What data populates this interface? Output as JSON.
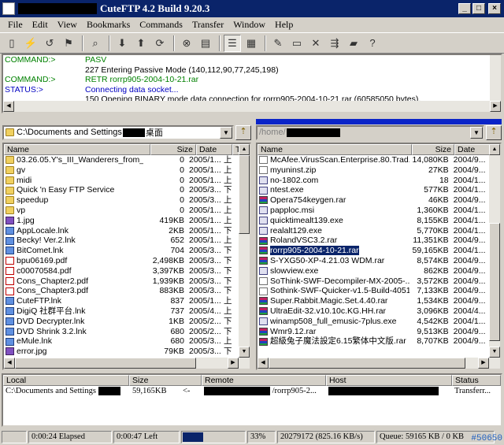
{
  "window": {
    "title": "CuteFTP 4.2 Build 9.20.3",
    "buttons": [
      "_",
      "□",
      "×"
    ]
  },
  "menu": [
    "File",
    "Edit",
    "View",
    "Bookmarks",
    "Commands",
    "Transfer",
    "Window",
    "Help"
  ],
  "toolbar_icons": [
    "connect-icon",
    "disconnect-icon",
    "reconnect-icon",
    "quick-connect-icon",
    "find-icon",
    "download-icon",
    "upload-icon",
    "refresh-icon",
    "stop-icon",
    "copy-icon",
    "list-view-icon",
    "details-view-icon",
    "edit-icon",
    "rename-icon",
    "delete-icon",
    "queue-icon",
    "new-folder-icon",
    "help-icon"
  ],
  "log": [
    {
      "label": "COMMAND:>",
      "msg": "PASV",
      "label_color": "green",
      "msg_color": "green"
    },
    {
      "label": "",
      "msg": "227 Entering Passive Mode (140,112,90,77,245,198)",
      "label_color": "black",
      "msg_color": "black"
    },
    {
      "label": "COMMAND:>",
      "msg": "RETR rorrp905-2004-10-21.rar",
      "label_color": "green",
      "msg_color": "green"
    },
    {
      "label": "STATUS:>",
      "msg": "Connecting data socket...",
      "label_color": "blue",
      "msg_color": "blue"
    },
    {
      "label": "",
      "msg": "150 Opening BINARY mode data connection for rorrp905-2004-10-21.rar (60585050 bytes).",
      "label_color": "black",
      "msg_color": "black"
    }
  ],
  "local": {
    "path_prefix": "C:\\Documents and Settings",
    "path_suffix": "桌面",
    "headers": {
      "name": "Name",
      "size": "Size",
      "date": "Date",
      "time": "T"
    },
    "files": [
      {
        "name": "03.26.05.Y's_III_Wanderers_from_Y...",
        "size": "0",
        "date": "2005/1...",
        "t": "上",
        "icon": "folder"
      },
      {
        "name": "gv",
        "size": "0",
        "date": "2005/1...",
        "t": "上",
        "icon": "folder"
      },
      {
        "name": "midi",
        "size": "0",
        "date": "2005/1...",
        "t": "上",
        "icon": "folder"
      },
      {
        "name": "Quick 'n Easy FTP Service",
        "size": "0",
        "date": "2005/3...",
        "t": "下",
        "icon": "folder"
      },
      {
        "name": "speedup",
        "size": "0",
        "date": "2005/3...",
        "t": "上",
        "icon": "folder"
      },
      {
        "name": "vp",
        "size": "0",
        "date": "2005/1...",
        "t": "上",
        "icon": "folder"
      },
      {
        "name": "1.jpg",
        "size": "419KB",
        "date": "2005/1...",
        "t": "上",
        "icon": "img"
      },
      {
        "name": "AppLocale.lnk",
        "size": "2KB",
        "date": "2005/1...",
        "t": "下",
        "icon": "lnk"
      },
      {
        "name": "Becky! Ver.2.lnk",
        "size": "652",
        "date": "2005/1...",
        "t": "上",
        "icon": "lnk"
      },
      {
        "name": "BitComet.lnk",
        "size": "704",
        "date": "2005/3...",
        "t": "下",
        "icon": "lnk"
      },
      {
        "name": "bpu06169.pdf",
        "size": "2,498KB",
        "date": "2005/3...",
        "t": "下",
        "icon": "pdf"
      },
      {
        "name": "c00070584.pdf",
        "size": "3,397KB",
        "date": "2005/3...",
        "t": "下",
        "icon": "pdf"
      },
      {
        "name": "Cons_Chapter2.pdf",
        "size": "1,939KB",
        "date": "2005/3...",
        "t": "下",
        "icon": "pdf"
      },
      {
        "name": "Cons_Chapter3.pdf",
        "size": "883KB",
        "date": "2005/3...",
        "t": "下",
        "icon": "pdf"
      },
      {
        "name": "CuteFTP.lnk",
        "size": "837",
        "date": "2005/1...",
        "t": "上",
        "icon": "lnk"
      },
      {
        "name": "DigiQ 社群平台.lnk",
        "size": "737",
        "date": "2005/4...",
        "t": "上",
        "icon": "lnk"
      },
      {
        "name": "DVD Decrypter.lnk",
        "size": "1KB",
        "date": "2005/2...",
        "t": "下",
        "icon": "lnk"
      },
      {
        "name": "DVD Shrink 3.2.lnk",
        "size": "680",
        "date": "2005/2...",
        "t": "下",
        "icon": "lnk"
      },
      {
        "name": "eMule.lnk",
        "size": "680",
        "date": "2005/3...",
        "t": "上",
        "icon": "lnk"
      },
      {
        "name": "error.jpg",
        "size": "79KB",
        "date": "2005/3...",
        "t": "下",
        "icon": "img"
      }
    ]
  },
  "remote": {
    "path_prefix": "/home/",
    "headers": {
      "name": "Name",
      "size": "Size",
      "date": "Date"
    },
    "selected": "rorrp905-2004-10-21.rar",
    "files": [
      {
        "name": "McAfee.VirusScan.Enterprise.80.Trad...",
        "size": "14,080KB",
        "date": "2004/9..."
      },
      {
        "name": "myuninst.zip",
        "size": "27KB",
        "date": "2004/9..."
      },
      {
        "name": "no-1802.com",
        "size": "18",
        "date": "2004/1..."
      },
      {
        "name": "ntest.exe",
        "size": "577KB",
        "date": "2004/1..."
      },
      {
        "name": "Opera754keygen.rar",
        "size": "46KB",
        "date": "2004/9..."
      },
      {
        "name": "papploc.msi",
        "size": "1,360KB",
        "date": "2004/1..."
      },
      {
        "name": "quicktimealt139.exe",
        "size": "8,155KB",
        "date": "2004/1..."
      },
      {
        "name": "realalt129.exe",
        "size": "5,770KB",
        "date": "2004/1..."
      },
      {
        "name": "RolandVSC3.2.rar",
        "size": "11,351KB",
        "date": "2004/9..."
      },
      {
        "name": "rorrp905-2004-10-21.rar",
        "size": "59,165KB",
        "date": "2004/1..."
      },
      {
        "name": "S-YXG50-XP-4.21.03 WDM.rar",
        "size": "8,574KB",
        "date": "2004/9..."
      },
      {
        "name": "slowview.exe",
        "size": "862KB",
        "date": "2004/9..."
      },
      {
        "name": "SoThink-SWF-Decompiler-MX-2005-...",
        "size": "3,572KB",
        "date": "2004/9..."
      },
      {
        "name": "Sothink-SWF-Quicker-v1.5-Build-4051...",
        "size": "7,133KB",
        "date": "2004/9..."
      },
      {
        "name": "Super.Rabbit.Magic.Set.4.40.rar",
        "size": "1,534KB",
        "date": "2004/9..."
      },
      {
        "name": "UltraEdit-32.v10.10c.KG.HH.rar",
        "size": "3,096KB",
        "date": "2004/4..."
      },
      {
        "name": "winamp508_full_emusic-7plus.exe",
        "size": "4,542KB",
        "date": "2004/1..."
      },
      {
        "name": "Wmr9.12.rar",
        "size": "9,513KB",
        "date": "2004/9..."
      },
      {
        "name": "超級兔子魔法設定6.15繁体中文版.rar",
        "size": "8,707KB",
        "date": "2004/9..."
      }
    ]
  },
  "queue": {
    "headers": {
      "local": "Local",
      "size": "Size",
      "remote": "Remote",
      "host": "Host",
      "status": "Status"
    },
    "items": [
      {
        "local": "C:\\Documents and Settings",
        "size": "59,165KB",
        "dir": "<-",
        "remote": "/rorrp905-2...",
        "status": "Transferr..."
      }
    ]
  },
  "status": {
    "elapsed": "0:00:24 Elapsed",
    "left": "0:00:47 Left",
    "progress": 0.33,
    "percent": "33%",
    "bytes": "20279172 (825.16 KB/s)",
    "queue": "Queue: 59165 KB / 0 KB",
    "badge": "#50650"
  }
}
